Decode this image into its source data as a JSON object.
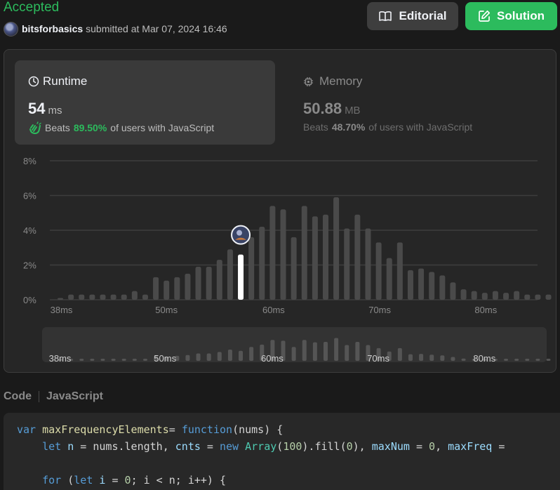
{
  "status": "Accepted",
  "submission": {
    "username": "bitsforbasics",
    "submitted_text": "submitted at Mar 07, 2024 16:46"
  },
  "buttons": {
    "editorial": "Editorial",
    "solution": "Solution"
  },
  "runtime": {
    "title": "Runtime",
    "value": "54",
    "unit": "ms",
    "beats_label": "Beats",
    "beats_pct": "89.50%",
    "beats_suffix": "of users with JavaScript"
  },
  "memory": {
    "title": "Memory",
    "value": "50.88",
    "unit": "MB",
    "beats_label": "Beats",
    "beats_pct": "48.70%",
    "beats_suffix": "of users with JavaScript"
  },
  "colors": {
    "accent_green": "#2cbb5d",
    "bar": "#4a4a4a",
    "highlight_bar": "#ffffff",
    "background": "#1a1a1a"
  },
  "chart_data": {
    "type": "bar",
    "x": [
      37,
      38,
      39,
      40,
      41,
      42,
      43,
      44,
      45,
      46,
      47,
      48,
      49,
      50,
      51,
      52,
      53,
      54,
      55,
      56,
      57,
      58,
      59,
      60,
      61,
      62,
      63,
      64,
      65,
      66,
      67,
      68,
      69,
      70,
      71,
      72,
      73,
      74,
      75,
      76,
      77,
      78,
      79,
      80,
      81,
      82,
      83,
      84,
      85
    ],
    "values": [
      0.1,
      0.3,
      0.3,
      0.3,
      0.3,
      0.3,
      0.3,
      0.5,
      0.3,
      1.3,
      1.1,
      1.3,
      1.5,
      1.9,
      1.9,
      2.3,
      2.9,
      2.6,
      3.6,
      4.2,
      5.4,
      5.2,
      3.6,
      5.4,
      4.8,
      4.9,
      5.9,
      4.1,
      4.9,
      4.1,
      3.3,
      2.4,
      3.3,
      1.7,
      1.8,
      1.6,
      1.4,
      1.0,
      0.6,
      0.5,
      0.4,
      0.5,
      0.4,
      0.5,
      0.3,
      0.3,
      0.3,
      0.3,
      0.3
    ],
    "highlight_x": 54,
    "highlight_value": 2.3,
    "xlabel": "",
    "ylabel": "",
    "xticks": [
      "38ms",
      "50ms",
      "60ms",
      "70ms",
      "80ms"
    ],
    "xtick_values": [
      37.1,
      47,
      57.1,
      67.1,
      77.1
    ],
    "yticks": [
      "0%",
      "2%",
      "4%",
      "6%",
      "8%"
    ],
    "ylim": [
      0,
      8
    ],
    "grid": true
  },
  "code": {
    "label": "Code",
    "language": "JavaScript",
    "lines": [
      [
        [
          "kw",
          "var "
        ],
        [
          "fn",
          "maxFrequencyElements"
        ],
        [
          "",
          "= "
        ],
        [
          "kw",
          "function"
        ],
        [
          "",
          "(nums) {"
        ]
      ],
      [
        [
          "",
          "    "
        ],
        [
          "kw",
          "let "
        ],
        [
          "vr",
          "n"
        ],
        [
          "",
          " = nums.length, "
        ],
        [
          "vr",
          "cnts"
        ],
        [
          "",
          " = "
        ],
        [
          "kw",
          "new "
        ],
        [
          "cl",
          "Array"
        ],
        [
          "",
          "("
        ],
        [
          "nm",
          "100"
        ],
        [
          "",
          ").fill("
        ],
        [
          "nm",
          "0"
        ],
        [
          "",
          "), "
        ],
        [
          "vr",
          "maxNum"
        ],
        [
          "",
          " = "
        ],
        [
          "nm",
          "0"
        ],
        [
          "",
          ", "
        ],
        [
          "vr",
          "maxFreq"
        ],
        [
          "",
          " ="
        ]
      ],
      [
        [
          "",
          ""
        ]
      ],
      [
        [
          "",
          "    "
        ],
        [
          "kw",
          "for "
        ],
        [
          "",
          "("
        ],
        [
          "kw",
          "let "
        ],
        [
          "vr",
          "i"
        ],
        [
          "",
          " = "
        ],
        [
          "nm",
          "0"
        ],
        [
          "",
          "; i < n; i++) {"
        ]
      ]
    ]
  }
}
